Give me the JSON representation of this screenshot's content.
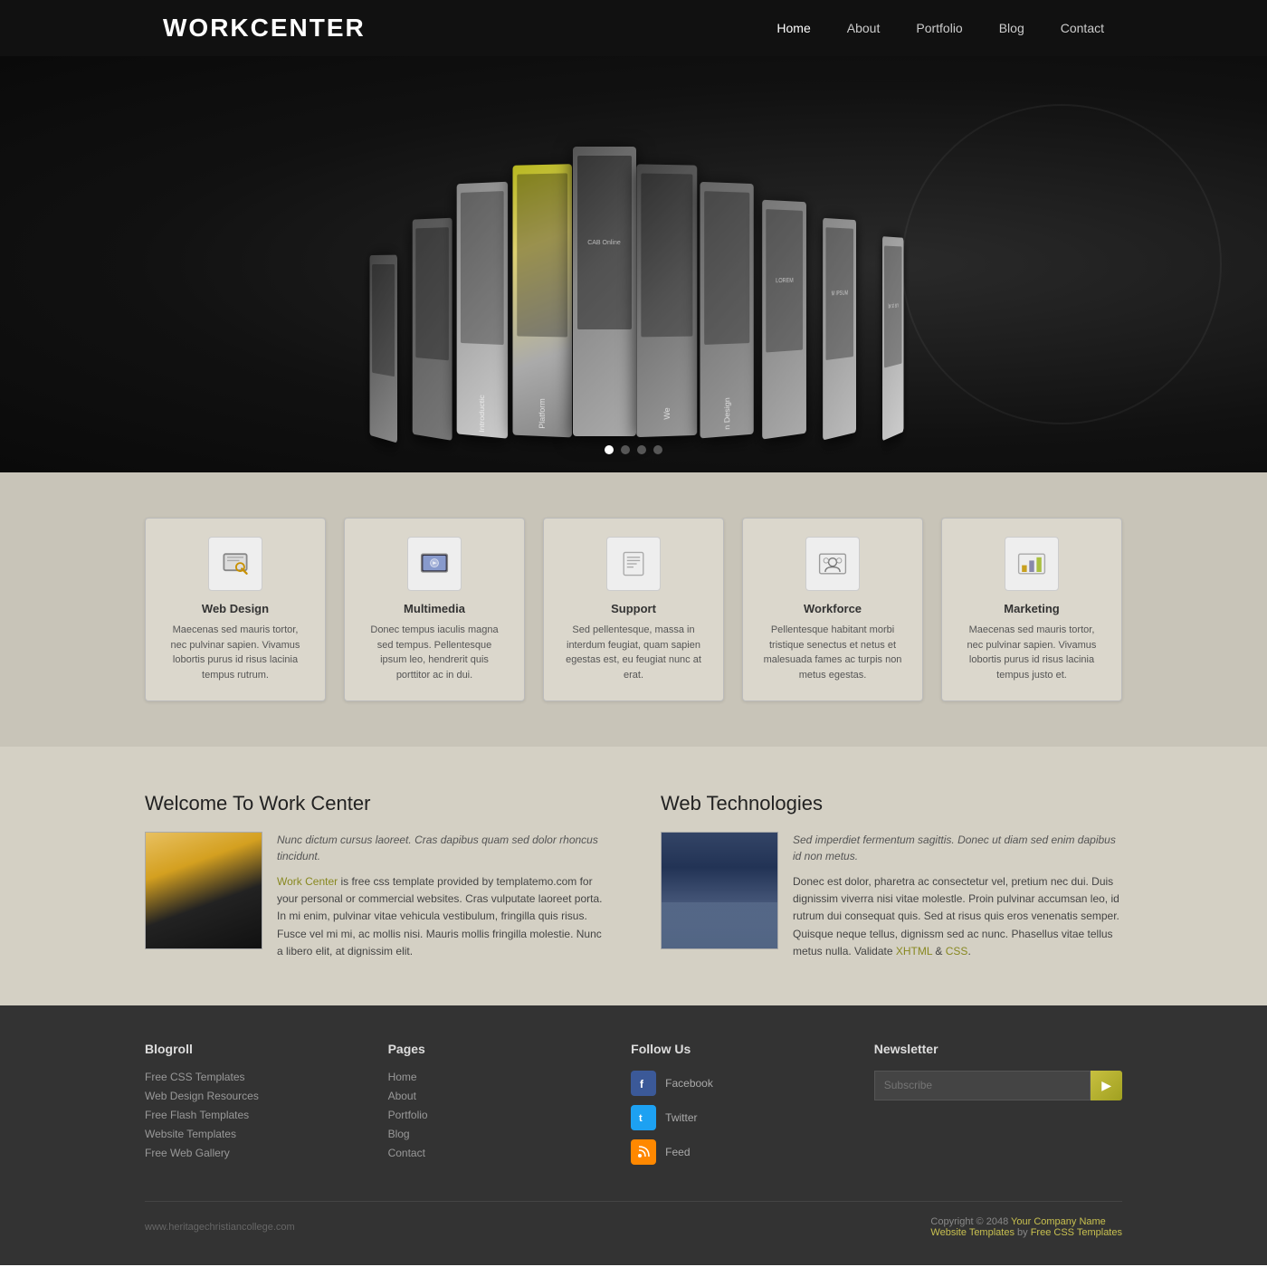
{
  "header": {
    "logo": "WORKCENTER",
    "nav": [
      {
        "label": "Home",
        "active": true
      },
      {
        "label": "About",
        "active": false
      },
      {
        "label": "Portfolio",
        "active": false
      },
      {
        "label": "Blog",
        "active": false
      },
      {
        "label": "Contact",
        "active": false
      }
    ]
  },
  "hero": {
    "dots": [
      "active",
      "",
      "",
      ""
    ],
    "cards": [
      {
        "label": ""
      },
      {
        "label": ""
      },
      {
        "label": "Introductic"
      },
      {
        "label": "Platform"
      },
      {
        "label": "CAB Online"
      },
      {
        "label": "We"
      },
      {
        "label": "n Design"
      },
      {
        "label": "LOREM"
      },
      {
        "label": "M IPSUM"
      },
      {
        "label": "lor sit am"
      }
    ]
  },
  "services": {
    "cards": [
      {
        "icon": "pencil",
        "title": "Web Design",
        "text": "Maecenas sed mauris tortor, nec pulvinar sapien. Vivamus lobortis purus id risus lacinia tempus rutrum."
      },
      {
        "icon": "photo",
        "title": "Multimedia",
        "text": "Donec tempus iaculis magna sed tempus. Pellentesque ipsum leo, hendrerit quis porttitor ac in dui."
      },
      {
        "icon": "document",
        "title": "Support",
        "text": "Sed pellentesque, massa in interdum feugiat, quam sapien egestas est, eu feugiat nunc at erat."
      },
      {
        "icon": "people",
        "title": "Workforce",
        "text": "Pellentesque habitant morbi tristique senectus et netus et malesuada fames ac turpis non metus egestas."
      },
      {
        "icon": "chart",
        "title": "Marketing",
        "text": "Maecenas sed mauris tortor, nec pulvinar sapien. Vivamus lobortis purus id risus lacinia tempus justo et."
      }
    ]
  },
  "welcome": {
    "title": "Welcome To Work Center",
    "italic_text": "Nunc dictum cursus laoreet. Cras dapibus quam sed dolor rhoncus tincidunt.",
    "link_text": "Work Center",
    "link_href": "#",
    "body_text": " is free css template provided by templatemo.com for your personal or commercial websites. Cras vulputate laoreet porta. In mi enim, pulvinar vitae vehicula vestibulum, fringilla quis risus. Fusce vel mi mi, ac mollis nisi. Mauris mollis fringilla molestie. Nunc a libero elit, at dignissim elit."
  },
  "web_tech": {
    "title": "Web Technologies",
    "italic_text": "Sed imperdiet fermentum sagittis. Donec ut diam sed enim dapibus id non metus.",
    "body_text": "Donec est dolor, pharetra ac consectetur vel, pretium nec dui. Duis dignissim viverra nisi vitae molestle. Proin pulvinar accumsan leo, id rutrum dui consequat quis. Sed at risus quis eros venenatis semper. Quisque neque tellus, dignissm sed ac nunc. Phasellus vitae tellus metus nulla. Validate ",
    "xhtml_link": "XHTML",
    "css_link": "CSS",
    "validate_text": " & "
  },
  "footer": {
    "blogroll_title": "Blogroll",
    "blogroll_links": [
      "Free CSS Templates",
      "Web Design Resources",
      "Free Flash Templates",
      "Website Templates",
      "Free Web Gallery"
    ],
    "pages_title": "Pages",
    "pages_links": [
      "Home",
      "About",
      "Portfolio",
      "Blog",
      "Contact"
    ],
    "follow_title": "Follow Us",
    "social": [
      {
        "name": "Facebook",
        "icon": "f",
        "class": "social-facebook"
      },
      {
        "name": "Twitter",
        "icon": "t",
        "class": "social-twitter"
      },
      {
        "name": "Feed",
        "icon": "rss",
        "class": "social-feed"
      }
    ],
    "newsletter_title": "Newsletter",
    "newsletter_placeholder": "Subscribe",
    "newsletter_btn": "▶",
    "bottom_left": "www.heritagechristiancollege.com",
    "bottom_right_pre": "Copyright © 2048 ",
    "bottom_company": "Your Company Name",
    "bottom_mid": "Website Templates",
    "bottom_by": " by ",
    "bottom_css": "Free CSS Templates"
  }
}
